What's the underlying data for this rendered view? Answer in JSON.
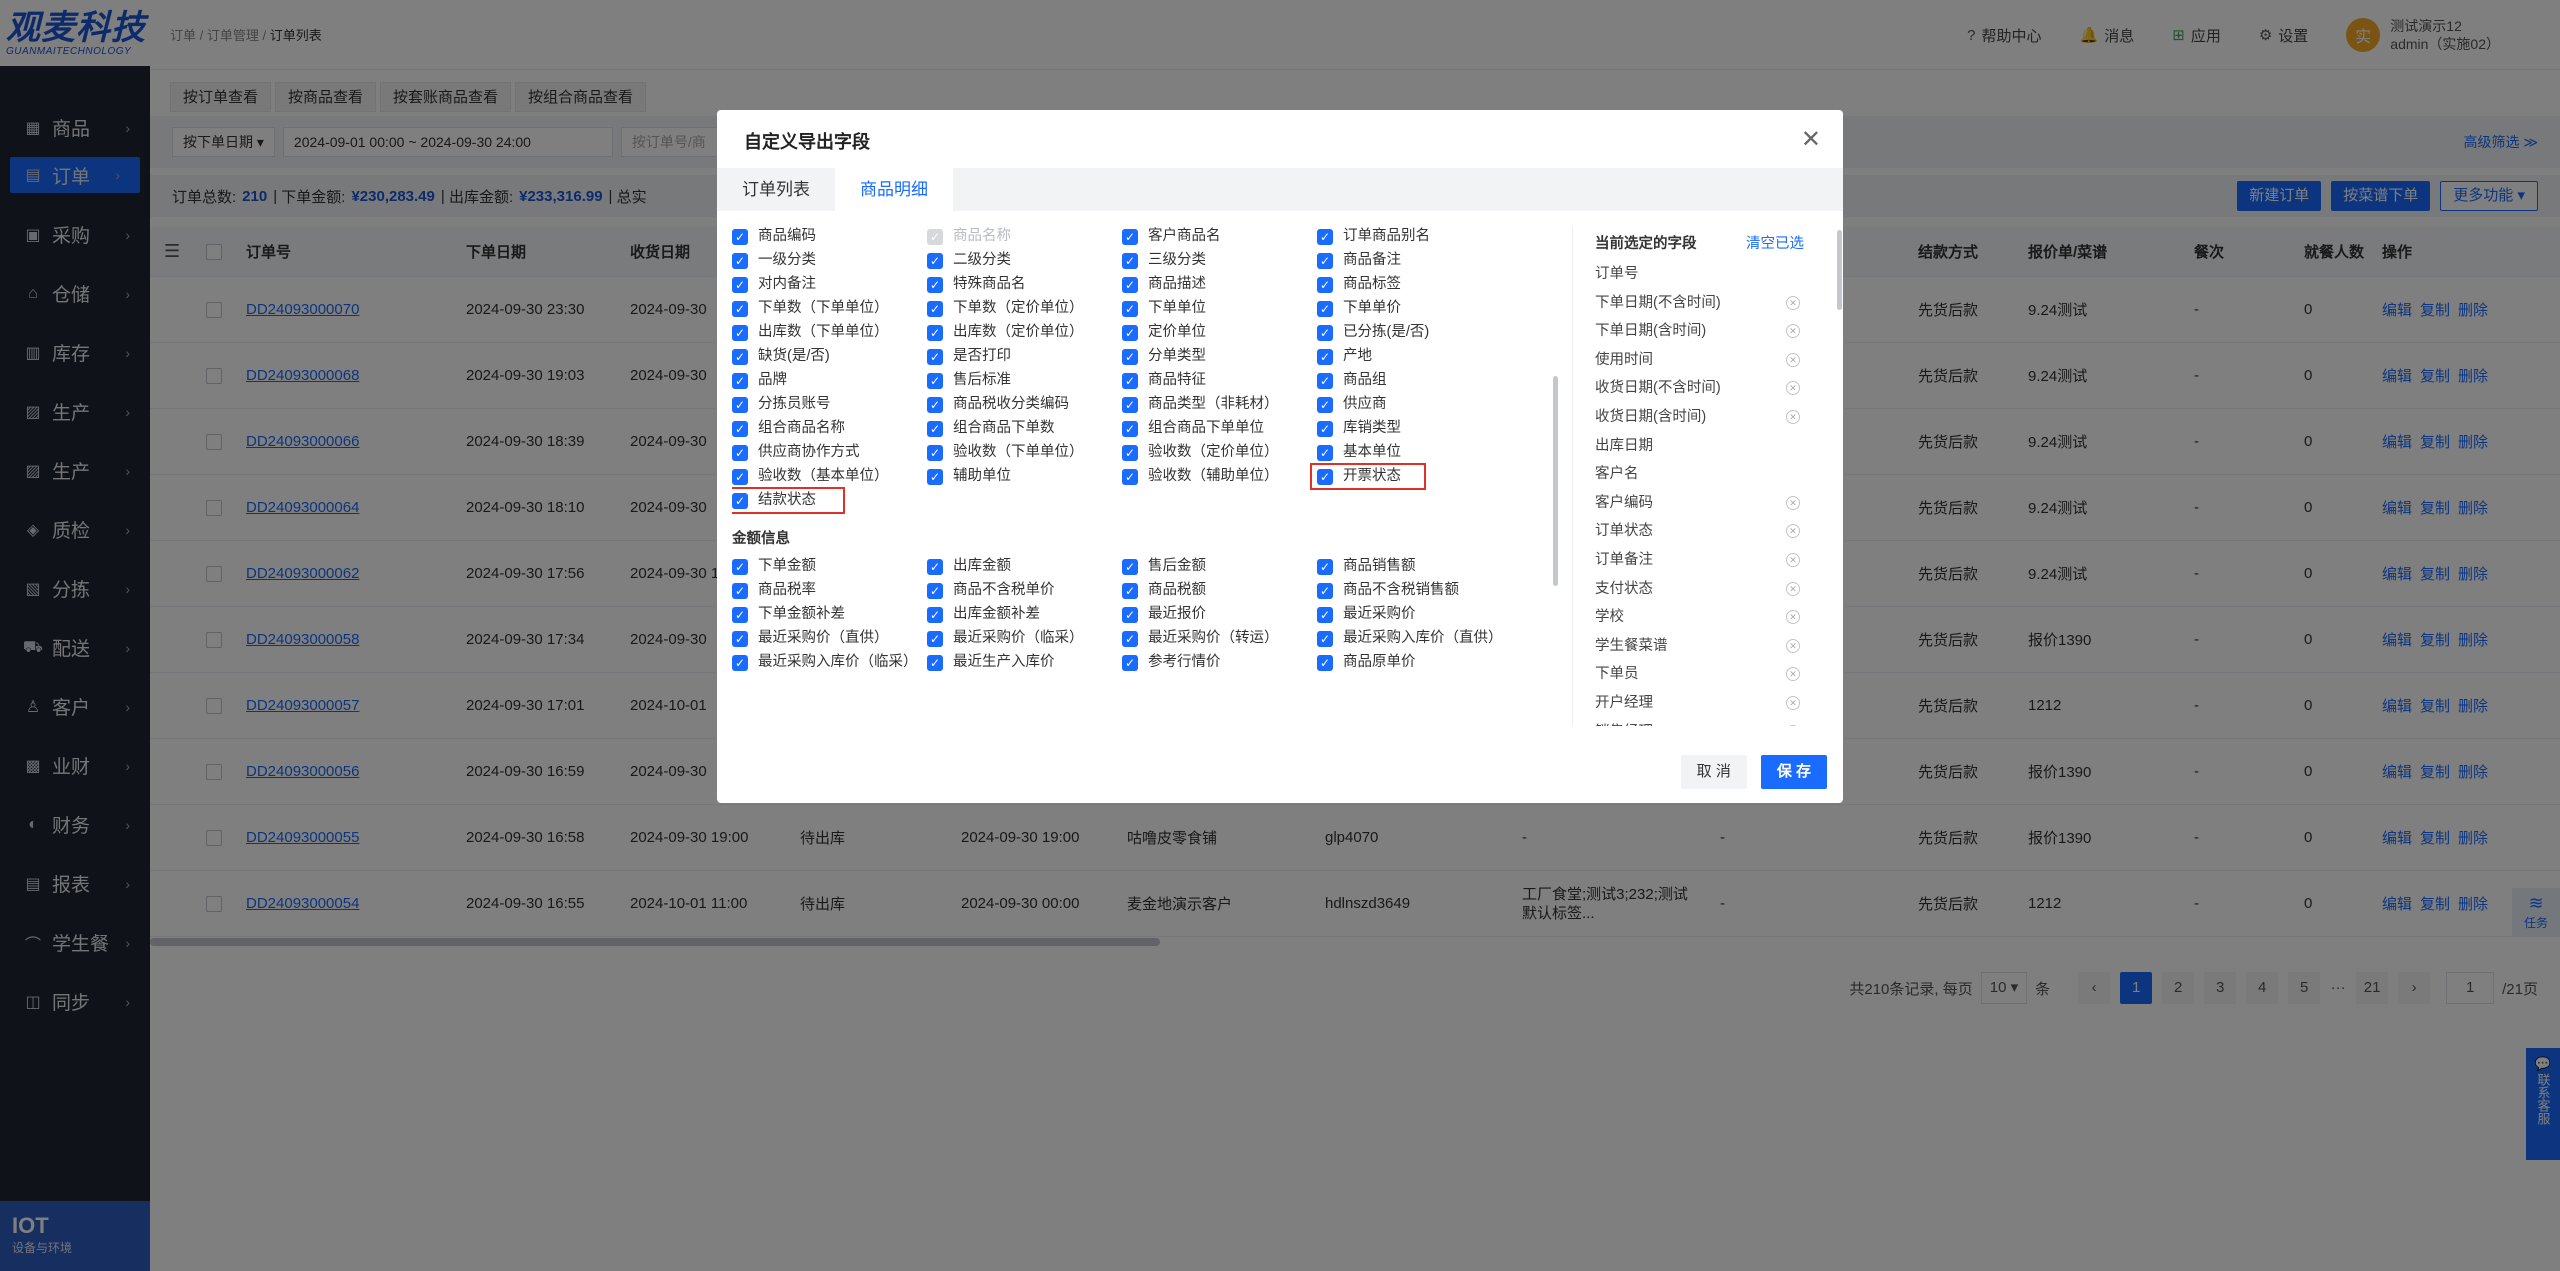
{
  "logo": {
    "cn": "观麦科技",
    "en": "GUANMAITECHNOLOGY"
  },
  "sidebar": {
    "items": [
      {
        "label": "商品",
        "icon": "grid-icon"
      },
      {
        "label": "订单",
        "icon": "order-icon"
      },
      {
        "label": "采购",
        "icon": "cart-icon"
      },
      {
        "label": "仓储",
        "icon": "box-icon"
      },
      {
        "label": "库存",
        "icon": "warehouse-icon"
      },
      {
        "label": "生产",
        "icon": "chart-icon"
      },
      {
        "label": "生产",
        "icon": "chart-icon"
      },
      {
        "label": "质检",
        "icon": "shield-icon"
      },
      {
        "label": "分拣",
        "icon": "sort-icon"
      },
      {
        "label": "配送",
        "icon": "truck-icon"
      },
      {
        "label": "客户",
        "icon": "user-icon"
      },
      {
        "label": "业财",
        "icon": "bar-icon"
      },
      {
        "label": "财务",
        "icon": "money-icon"
      },
      {
        "label": "报表",
        "icon": "report-icon"
      },
      {
        "label": "学生餐",
        "icon": "cap-icon"
      },
      {
        "label": "同步",
        "icon": "sync-icon"
      }
    ],
    "bottom_title": "IOT",
    "bottom_sub": "设备与环境"
  },
  "topbar": {
    "breadcrumb": [
      "订单",
      "订单管理",
      "订单列表"
    ],
    "help": "帮助中心",
    "messages": "消息",
    "apps": "应用",
    "settings": "设置",
    "avatar": "实",
    "user_name": "测试演示12",
    "user_account": "admin（实施02）"
  },
  "view_tabs": [
    "按订单查看",
    "按商品查看",
    "按套账商品查看",
    "按组合商品查看"
  ],
  "filter": {
    "date_type": "按下单日期",
    "date_range": "2024-09-01 00:00 ~ 2024-09-30 24:00",
    "search_placeholder": "按订单号/商",
    "advanced": "高级筛选"
  },
  "summary": {
    "total_label": "订单总数:",
    "total": "210",
    "order_amount_label": "下单金额:",
    "order_amount": "¥230,283.49",
    "out_amount_label": "出库金额:",
    "out_amount": "¥233,316.99",
    "more_label": "总实",
    "new_order": "新建订单",
    "by_menu": "按菜谱下单",
    "more": "更多功能"
  },
  "table": {
    "headers": [
      "订单号",
      "下单日期",
      "收货日期",
      "结款方式",
      "报价单/菜谱",
      "餐次",
      "就餐人数",
      "操作"
    ],
    "rows": [
      {
        "id": "DD24093000070",
        "order_date": "2024-09-30 23:30",
        "recv": "2024-09-30",
        "pay": "先货后款",
        "quote": "9.24测试",
        "meal": "-",
        "people": "0"
      },
      {
        "id": "DD24093000068",
        "order_date": "2024-09-30 19:03",
        "recv": "2024-09-30",
        "pay": "先货后款",
        "quote": "9.24测试",
        "meal": "-",
        "people": "0"
      },
      {
        "id": "DD24093000066",
        "order_date": "2024-09-30 18:39",
        "recv": "2024-09-30",
        "pay": "先货后款",
        "quote": "9.24测试",
        "meal": "-",
        "people": "0"
      },
      {
        "id": "DD24093000064",
        "order_date": "2024-09-30 18:10",
        "recv": "2024-09-30",
        "pay": "先货后款",
        "quote": "9.24测试",
        "meal": "-",
        "people": "0"
      },
      {
        "id": "DD24093000062",
        "order_date": "2024-09-30 17:56",
        "recv": "2024-09-30 1",
        "pay": "先货后款",
        "quote": "9.24测试",
        "meal": "-",
        "people": "0"
      },
      {
        "id": "DD24093000058",
        "order_date": "2024-09-30 17:34",
        "recv": "2024-09-30",
        "pay": "先货后款",
        "quote": "报价1390",
        "meal": "-",
        "people": "0"
      },
      {
        "id": "DD24093000057",
        "order_date": "2024-09-30 17:01",
        "recv": "2024-10-01",
        "pay": "先货后款",
        "quote": "1212",
        "meal": "-",
        "people": "0"
      },
      {
        "id": "DD24093000056",
        "order_date": "2024-09-30 16:59",
        "recv": "2024-09-30",
        "pay": "先货后款",
        "quote": "报价1390",
        "meal": "-",
        "people": "0"
      },
      {
        "id": "DD24093000055",
        "order_date": "2024-09-30 16:58",
        "recv": "2024-09-30 19:00",
        "status": "待出库",
        "out_date": "2024-09-30 19:00",
        "customer": "咕噜皮零食铺",
        "code": "glp4070",
        "remark": "-",
        "dash": "-",
        "pay": "先货后款",
        "quote": "报价1390",
        "meal": "-",
        "people": "0"
      },
      {
        "id": "DD24093000054",
        "order_date": "2024-09-30 16:55",
        "recv": "2024-10-01 11:00",
        "status": "待出库",
        "out_date": "2024-09-30 00:00",
        "customer": "麦金地演示客户",
        "code": "hdlnszd3649",
        "remark": "工厂食堂;测试3;232;测试默认标签...",
        "dash": "-",
        "pay": "先货后款",
        "quote": "1212",
        "meal": "-",
        "people": "0"
      }
    ],
    "ops": [
      "编辑",
      "复制",
      "删除"
    ]
  },
  "pager": {
    "total_text": "共210条记录, 每页",
    "size": "10",
    "unit": "条",
    "prev": "‹",
    "pages": [
      "1",
      "2",
      "3",
      "4",
      "5",
      "···",
      "21"
    ],
    "next": "›",
    "jump": "1",
    "total_pages": "/21页"
  },
  "dialog": {
    "title": "自定义导出字段",
    "tabs": [
      "订单列表",
      "商品明细"
    ],
    "fields": [
      "商品编码",
      "商品名称",
      "客户商品名",
      "订单商品别名",
      "一级分类",
      "二级分类",
      "三级分类",
      "商品备注",
      "对内备注",
      "特殊商品名",
      "商品描述",
      "商品标签",
      "下单数（下单单位）",
      "下单数（定价单位）",
      "下单单位",
      "下单单价",
      "出库数（下单单位）",
      "出库数（定价单位）",
      "定价单位",
      "已分拣(是/否)",
      "缺货(是/否)",
      "是否打印",
      "分单类型",
      "产地",
      "品牌",
      "售后标准",
      "商品特征",
      "商品组",
      "分拣员账号",
      "商品税收分类编码",
      "商品类型（非耗材）",
      "供应商",
      "组合商品名称",
      "组合商品下单数",
      "组合商品下单单位",
      "库销类型",
      "供应商协作方式",
      "验收数（下单单位）",
      "验收数（定价单位）",
      "基本单位",
      "验收数（基本单位）",
      "辅助单位",
      "验收数（辅助单位）",
      "开票状态",
      "结款状态"
    ],
    "section_amount": "金额信息",
    "amount_fields": [
      "下单金额",
      "出库金额",
      "售后金额",
      "商品销售额",
      "商品税率",
      "商品不含税单价",
      "商品税额",
      "商品不含税销售额",
      "下单金额补差",
      "出库金额补差",
      "最近报价",
      "最近采购价",
      "最近采购价（直供）",
      "最近采购价（临采）",
      "最近采购价（转运）",
      "最近采购入库价（直供）",
      "最近采购入库价（临采）",
      "最近生产入库价",
      "参考行情价",
      "商品原单价"
    ],
    "selected_title": "当前选定的字段",
    "clear": "清空已选",
    "selected": [
      "订单号",
      "下单日期(不含时间)",
      "下单日期(含时间)",
      "使用时间",
      "收货日期(不含时间)",
      "收货日期(含时间)",
      "出库日期",
      "客户名",
      "客户编码",
      "订单状态",
      "订单备注",
      "支付状态",
      "学校",
      "学生餐菜谱",
      "下单员",
      "开户经理",
      "销售经理"
    ],
    "cancel": "取 消",
    "save": "保 存"
  },
  "float": {
    "task": "任务",
    "contact": "联系客服"
  }
}
